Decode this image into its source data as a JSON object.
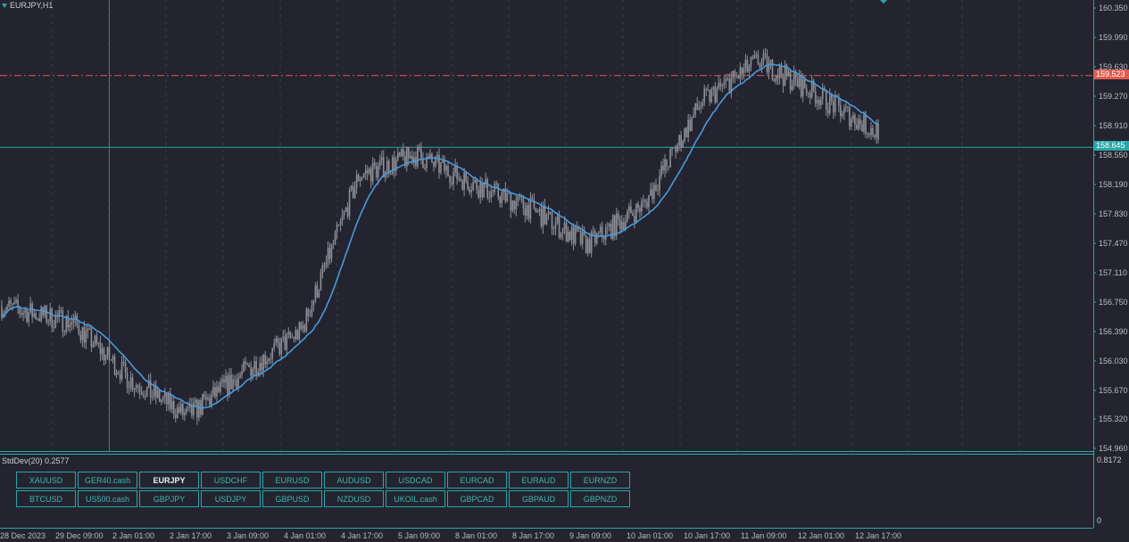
{
  "chart_title": "EURJPY,H1",
  "indicator_label": "StdDev(20) 0.2577",
  "indicator_scale": {
    "max": "0.8172",
    "min": "0"
  },
  "price_levels": [
    "160.350",
    "159.990",
    "159.630",
    "159.270",
    "158.910",
    "158.550",
    "158.190",
    "157.830",
    "157.470",
    "157.110",
    "156.750",
    "156.390",
    "156.030",
    "155.670",
    "155.320",
    "154.960"
  ],
  "price_tags": {
    "red": "159.523",
    "teal": "158.645"
  },
  "time_labels": [
    "28 Dec 2023",
    "29 Dec 09:00",
    "2 Jan 01:00",
    "2 Jan 17:00",
    "3 Jan 09:00",
    "4 Jan 01:00",
    "4 Jan 17:00",
    "5 Jan 09:00",
    "8 Jan 01:00",
    "8 Jan 17:00",
    "9 Jan 09:00",
    "10 Jan 01:00",
    "10 Jan 17:00",
    "11 Jan 09:00",
    "12 Jan 01:00",
    "12 Jan 17:00"
  ],
  "colors": {
    "background": "#23242f",
    "accent": "#2aa7a8",
    "red_line": "#e25a4f",
    "ma_line": "#4a9ad8",
    "candle": "#8e8f96"
  },
  "symbol_buttons": [
    [
      {
        "label": "XAUUSD",
        "active": false
      },
      {
        "label": "GER40.cash",
        "active": false
      },
      {
        "label": "EURJPY",
        "active": true
      },
      {
        "label": "USDCHF",
        "active": false
      },
      {
        "label": "EURUSD",
        "active": false
      },
      {
        "label": "AUDUSD",
        "active": false
      },
      {
        "label": "USDCAD",
        "active": false
      },
      {
        "label": "EURCAD",
        "active": false
      },
      {
        "label": "EURAUD",
        "active": false
      },
      {
        "label": "EURNZD",
        "active": false
      }
    ],
    [
      {
        "label": "BTCUSD",
        "active": false
      },
      {
        "label": "US500.cash",
        "active": false
      },
      {
        "label": "GBPJPY",
        "active": false
      },
      {
        "label": "USDJPY",
        "active": false
      },
      {
        "label": "GBPUSD",
        "active": false
      },
      {
        "label": "NZDUSD",
        "active": false
      },
      {
        "label": "UKOIL.cash",
        "active": false
      },
      {
        "label": "GBPCAD",
        "active": false
      },
      {
        "label": "GBPAUD",
        "active": false
      },
      {
        "label": "GBPNZD",
        "active": false
      }
    ]
  ],
  "chart_data": {
    "type": "line",
    "symbol": "EURJPY",
    "timeframe": "H1",
    "ylim": [
      154.96,
      160.35
    ],
    "grid": true,
    "horizontal_lines": [
      159.523,
      158.645
    ],
    "series": [
      {
        "x": [
          "28 Dec 2023",
          "29 Dec 09:00",
          "2 Jan 01:00",
          "2 Jan 17:00",
          "3 Jan 09:00",
          "4 Jan 01:00",
          "4 Jan 17:00",
          "5 Jan 09:00",
          "8 Jan 01:00",
          "8 Jan 17:00",
          "9 Jan 09:00",
          "10 Jan 01:00",
          "10 Jan 17:00",
          "11 Jan 09:00",
          "12 Jan 01:00",
          "12 Jan 17:00"
        ],
        "values": [
          156.7,
          156.5,
          155.8,
          155.35,
          155.9,
          156.4,
          158.3,
          158.55,
          158.2,
          157.9,
          157.45,
          157.95,
          159.2,
          159.7,
          159.3,
          158.85
        ]
      }
    ]
  }
}
